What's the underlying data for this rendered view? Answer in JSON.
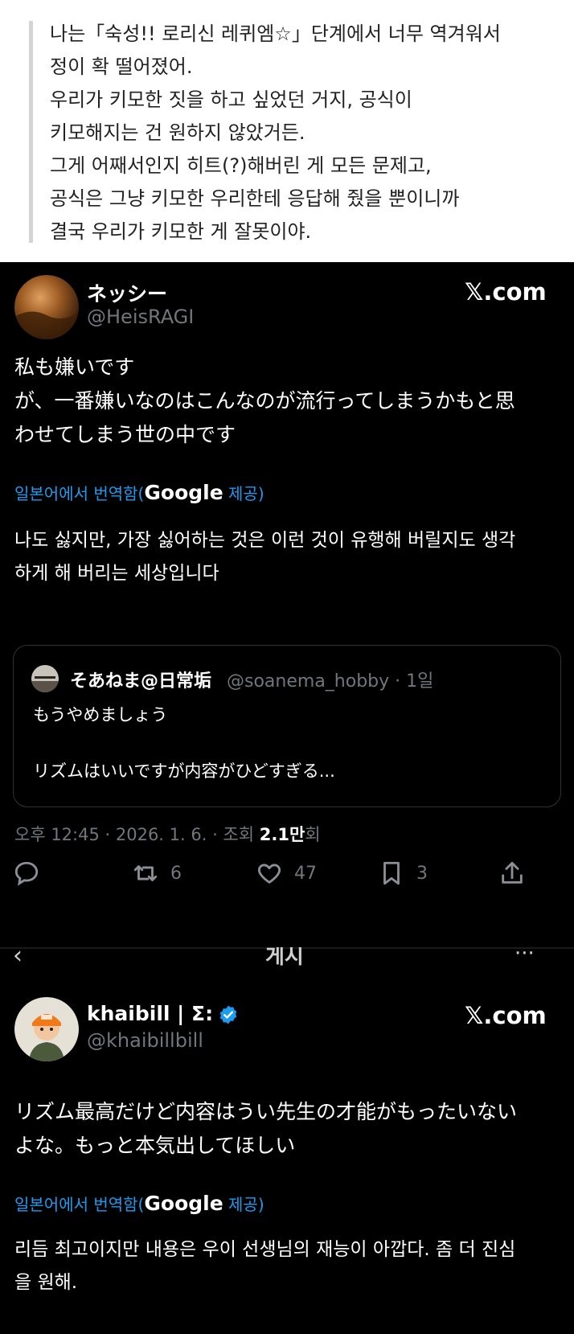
{
  "quote_block": {
    "lines": [
      "나는「숙성!! 로리신 레퀴엠☆」단계에서 너무 역겨워서",
      "정이 확 떨어졌어.",
      "우리가 키모한 짓을 하고 싶었던 거지, 공식이",
      "키모해지는 건 원하지 않았거든.",
      "그게 어째서인지 히트(?)해버린 게 모든 문제고,",
      "공식은 그냥 키모한 우리한테 응답해 줬을 뿐이니까",
      "결국 우리가 키모한 게 잘못이야."
    ]
  },
  "tweet1": {
    "display_name": "ネッシー",
    "handle": "@HeisRAGI",
    "source": "𝕏.com",
    "body_lines": [
      "私も嫌いです",
      "が、一番嫌いなのはこんなのが流行ってしまうかもと思",
      "わせてしまう世の中です"
    ],
    "translate_prefix": "일본어에서 번역함(",
    "translate_brand": "Google",
    "translate_suffix": " 제공)",
    "translated_lines": [
      "나도 싫지만, 가장 싫어하는 것은 이런 것이 유행해 버릴지도 생각",
      "하게 해 버리는 세상입니다"
    ],
    "quoted": {
      "display_name": "そあねま@日常垢",
      "handle_time": "@soanema_hobby · 1일",
      "line1": "もうやめましょう",
      "line2": "リズムはいいですが内容がひどすぎる..."
    },
    "meta_prefix": "오후 12:45 · 2026. 1. 6. · 조회 ",
    "views": "2.1만",
    "meta_suffix": "회",
    "actions": {
      "reply_icon": "reply-icon",
      "retweet_icon": "retweet-icon",
      "retweets": "6",
      "like_icon": "heart-icon",
      "likes": "47",
      "bookmark_icon": "bookmark-icon",
      "bookmarks": "3",
      "share_icon": "share-icon"
    }
  },
  "strip": {
    "back": "‹",
    "title": "게시",
    "more": "···"
  },
  "tweet2": {
    "display_name": "khaibill | Σ:",
    "handle": "@khaibillbill",
    "source": "𝕏.com",
    "body_lines": [
      "リズム最高だけど内容はうい先生の才能がもったいない",
      "よな。もっと本気出してほしい"
    ],
    "translate_prefix": "일본어에서 번역함(",
    "translate_brand": "Google",
    "translate_suffix": " 제공)",
    "translated_lines": [
      "리듬 최고이지만 내용은 우이 선생님의 재능이 아깝다. 좀 더 진심",
      "을 원해."
    ]
  },
  "colors": {
    "accent": "#1d9bf0",
    "muted": "#71767b",
    "verified": "#1d9bf0"
  }
}
